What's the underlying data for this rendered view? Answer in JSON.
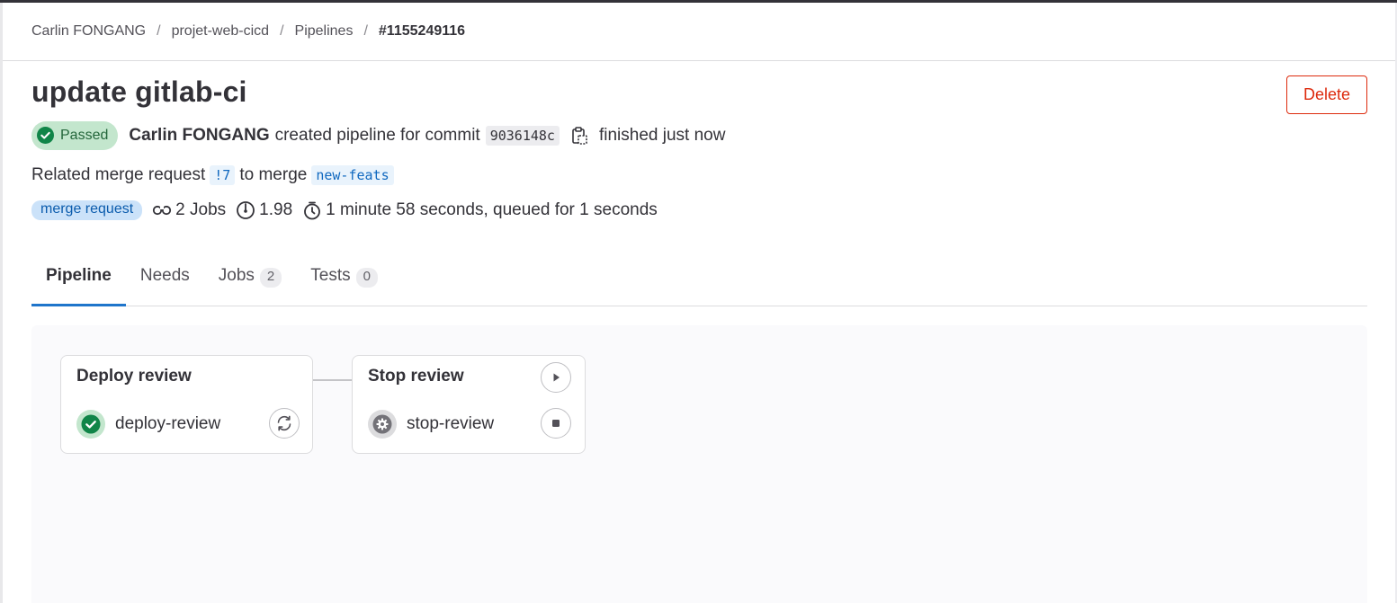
{
  "breadcrumb": {
    "items": [
      "Carlin FONGANG",
      "projet-web-cicd",
      "Pipelines",
      "#1155249116"
    ],
    "separator": "/"
  },
  "page": {
    "title": "update gitlab-ci",
    "delete_label": "Delete"
  },
  "status": {
    "badge_label": "Passed",
    "author": "Carlin FONGANG",
    "created_text": "created pipeline for commit",
    "commit_sha": "9036148c",
    "finished_text": "finished just now"
  },
  "related": {
    "prefix": "Related merge request",
    "mr_ref": "!7",
    "to_merge": "to merge",
    "branch": "new-feats"
  },
  "meta": {
    "badge": "merge request",
    "jobs": "2 Jobs",
    "compute": "1.98",
    "duration": "1 minute 58 seconds, queued for 1 seconds"
  },
  "tabs": [
    {
      "label": "Pipeline",
      "count": null
    },
    {
      "label": "Needs",
      "count": null
    },
    {
      "label": "Jobs",
      "count": "2"
    },
    {
      "label": "Tests",
      "count": "0"
    }
  ],
  "stages": [
    {
      "title": "Deploy review",
      "job": "deploy-review",
      "job_status": "success"
    },
    {
      "title": "Stop review",
      "job": "stop-review",
      "job_status": "manual"
    }
  ],
  "colors": {
    "success": "#108548",
    "danger": "#dd2b0e",
    "link": "#1068bf",
    "tab_active": "#1f75cb"
  },
  "icons": {
    "status": "check-circle-icon",
    "copy": "copy-to-clipboard-icon",
    "jobs": "pipeline-icon",
    "compute": "timer-dial-icon",
    "duration": "stopwatch-icon",
    "retry": "retry-icon",
    "play": "play-icon",
    "stop": "stop-icon",
    "manual": "gear-icon"
  }
}
